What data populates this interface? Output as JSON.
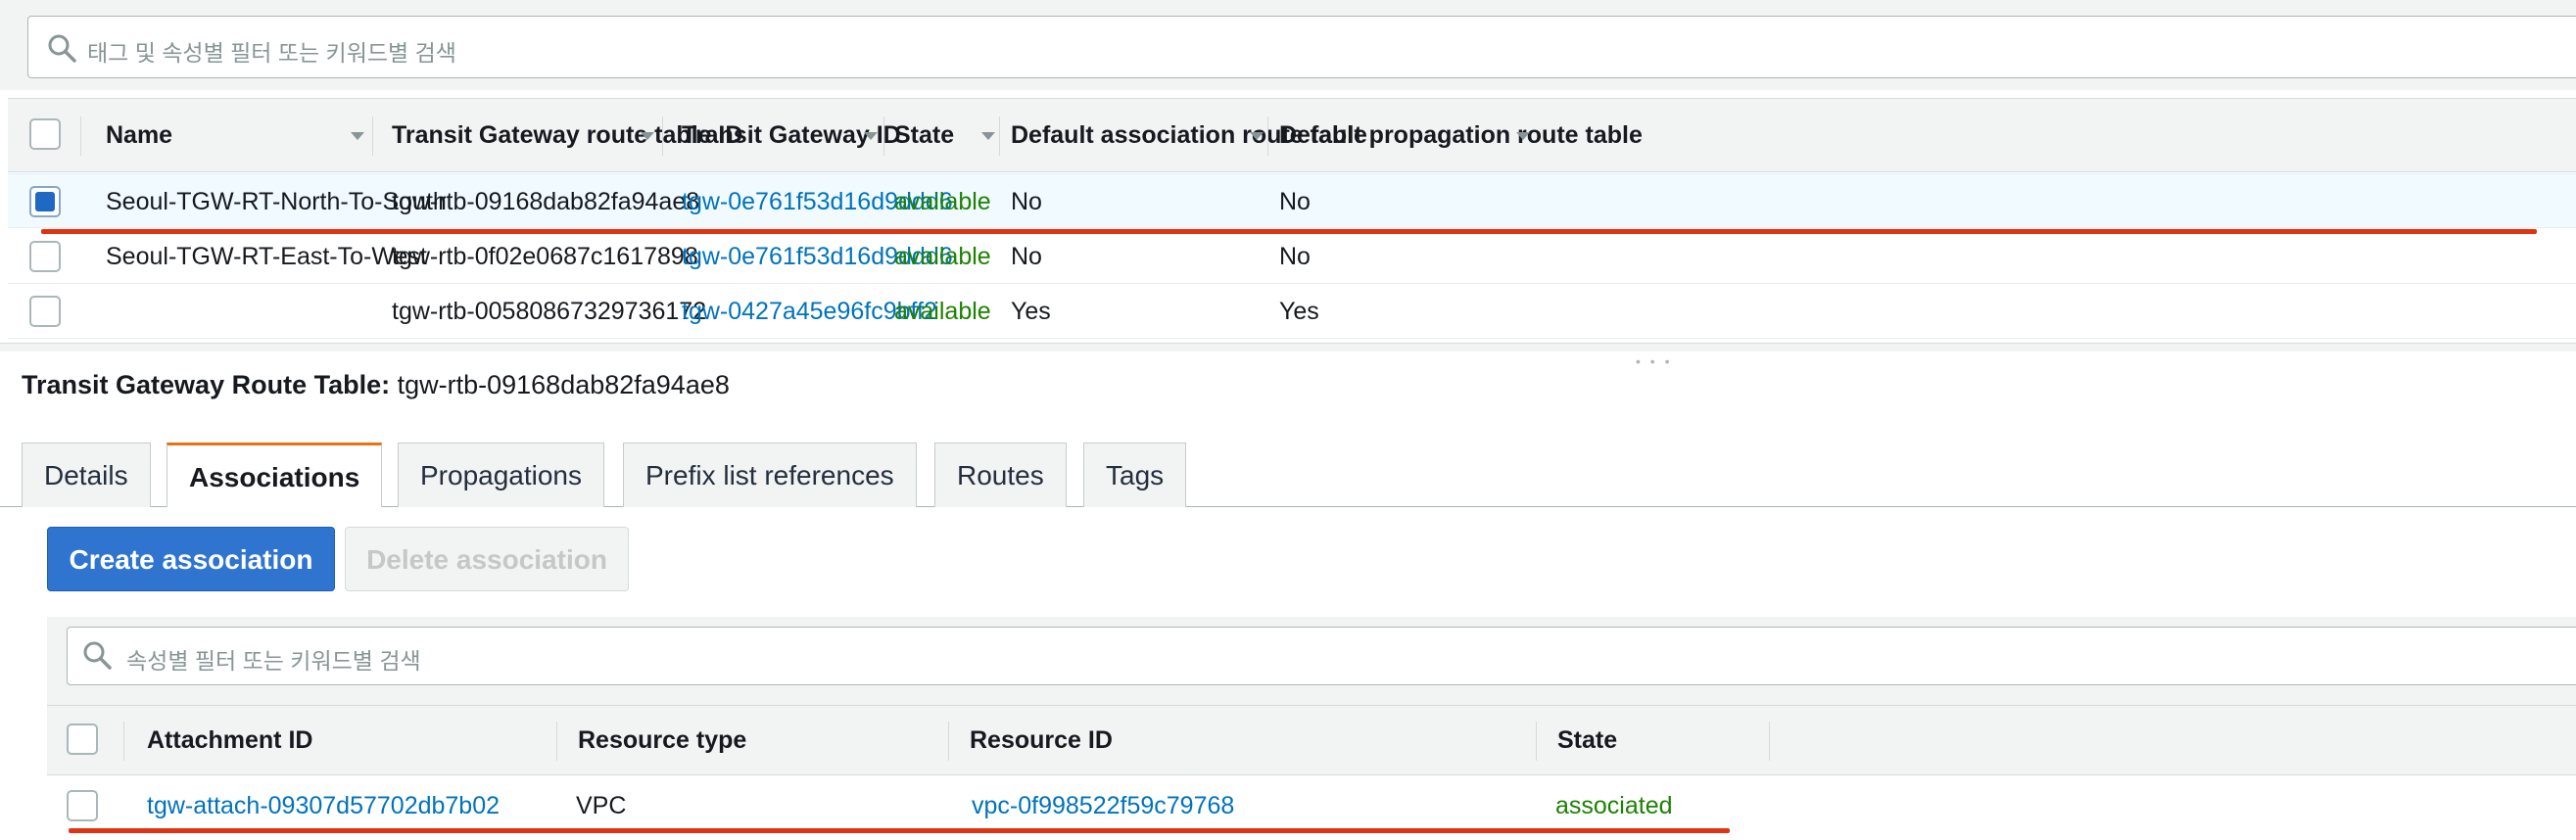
{
  "search": {
    "placeholder": "태그 및 속성별 필터 또는 키워드별 검색"
  },
  "route_tables": {
    "columns": [
      "Name",
      "Transit Gateway route table ID",
      "Transit Gateway ID",
      "State",
      "Default association route table",
      "Default propagation route table"
    ],
    "rows": [
      {
        "selected": true,
        "name": "Seoul-TGW-RT-North-To-South",
        "route_table_id": "tgw-rtb-09168dab82fa94ae8",
        "tgw_id": "tgw-0e761f53d16d9ddd6",
        "state": "available",
        "default_association": "No",
        "default_propagation": "No"
      },
      {
        "selected": false,
        "name": "Seoul-TGW-RT-East-To-West",
        "route_table_id": "tgw-rtb-0f02e0687c1617898",
        "tgw_id": "tgw-0e761f53d16d9ddd6",
        "state": "available",
        "default_association": "No",
        "default_propagation": "No"
      },
      {
        "selected": false,
        "name": "",
        "route_table_id": "tgw-rtb-00580867329736172",
        "tgw_id": "tgw-0427a45e96fc9bff2",
        "state": "available",
        "default_association": "Yes",
        "default_propagation": "Yes"
      }
    ]
  },
  "detail": {
    "label": "Transit Gateway Route Table:",
    "value": "tgw-rtb-09168dab82fa94ae8"
  },
  "tabs": [
    {
      "label": "Details",
      "active": false
    },
    {
      "label": "Associations",
      "active": true
    },
    {
      "label": "Propagations",
      "active": false
    },
    {
      "label": "Prefix list references",
      "active": false
    },
    {
      "label": "Routes",
      "active": false
    },
    {
      "label": "Tags",
      "active": false
    }
  ],
  "actions": {
    "create": "Create association",
    "delete": "Delete association"
  },
  "assoc_search": {
    "placeholder": "속성별 필터 또는 키워드별 검색"
  },
  "associations": {
    "columns": [
      "Attachment ID",
      "Resource type",
      "Resource ID",
      "State"
    ],
    "rows": [
      {
        "attachment_id": "tgw-attach-09307d57702db7b02",
        "resource_type": "VPC",
        "resource_id": "vpc-0f998522f59c79768",
        "state": "associated"
      }
    ]
  },
  "colors": {
    "link": "#0073bb",
    "ok": "#1d8102",
    "primary": "#2f74cf",
    "annotation": "#df3312",
    "active_tab": "#ec7211"
  }
}
